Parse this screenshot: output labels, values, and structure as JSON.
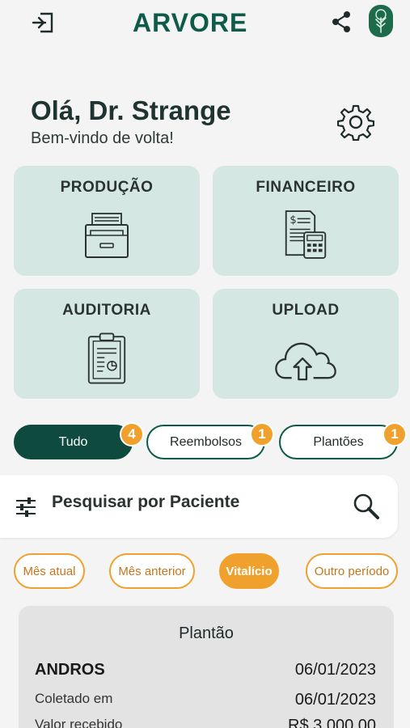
{
  "app": {
    "brand": "ARVORE",
    "brand_accent_color": "#e8941f",
    "primary_color": "#0f5b4a",
    "icons": [
      "logout-icon",
      "share-icon",
      "tree-logo-icon",
      "gear-icon"
    ]
  },
  "greeting": {
    "title": "Olá, Dr. Strange",
    "subtitle": "Bem-vindo de volta!"
  },
  "cards": [
    {
      "label": "PRODUÇÃO",
      "icon": "drawer-icon"
    },
    {
      "label": "FINANCEIRO",
      "icon": "invoice-calculator-icon"
    },
    {
      "label": "AUDITORIA",
      "icon": "clipboard-icon"
    },
    {
      "label": "UPLOAD",
      "icon": "cloud-upload-icon"
    }
  ],
  "filters": [
    {
      "label": "Tudo",
      "count": "4",
      "active": true
    },
    {
      "label": "Reembolsos",
      "count": "1",
      "active": false
    },
    {
      "label": "Plantões",
      "count": "1",
      "active": false
    }
  ],
  "search": {
    "label": "Pesquisar por Paciente"
  },
  "periods": [
    {
      "label": "Mês atual",
      "active": false
    },
    {
      "label": "Mês anterior",
      "active": false
    },
    {
      "label": "Vitalício",
      "active": true
    },
    {
      "label": "Outro período",
      "active": false
    }
  ],
  "record": {
    "title": "Plantão",
    "name": "ANDROS",
    "date": "06/01/2023",
    "collected_label": "Coletado em",
    "collected_value": "06/01/2023",
    "received_label": "Valor recebido",
    "received_value": "R$ 3.000,00"
  }
}
